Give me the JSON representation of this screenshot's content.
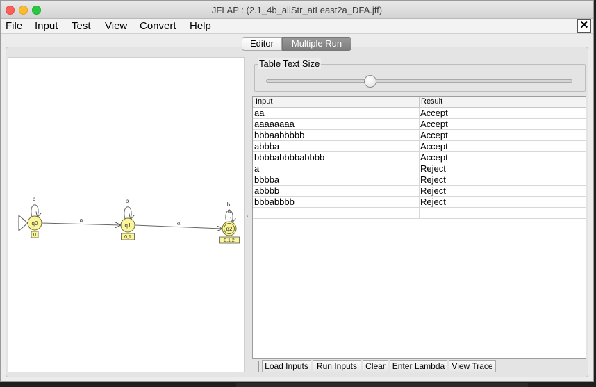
{
  "window": {
    "title": "JFLAP : (2.1_4b_allStr_atLeast2a_DFA.jff)"
  },
  "menu": {
    "items": [
      "File",
      "Input",
      "Test",
      "View",
      "Convert",
      "Help"
    ],
    "close_label": "✕"
  },
  "tabs": [
    "Editor",
    "Multiple Run"
  ],
  "automaton": {
    "states": [
      {
        "name": "q0",
        "label": "0",
        "initial": true,
        "final": false
      },
      {
        "name": "q1",
        "label": "0,1",
        "initial": false,
        "final": false
      },
      {
        "name": "q2",
        "label": "0,1,2",
        "initial": false,
        "final": true
      }
    ],
    "transitions": [
      {
        "from": "q0",
        "to": "q0",
        "symbol": "b"
      },
      {
        "from": "q0",
        "to": "q1",
        "symbol": "a"
      },
      {
        "from": "q1",
        "to": "q1",
        "symbol": "b"
      },
      {
        "from": "q1",
        "to": "q2",
        "symbol": "a"
      },
      {
        "from": "q2",
        "to": "q2",
        "symbol": "b"
      },
      {
        "from": "q2",
        "to": "q2",
        "symbol": "a"
      }
    ]
  },
  "table_text_size": {
    "label": "Table Text Size",
    "slider_fraction": 0.34
  },
  "table": {
    "headers": [
      "Input",
      "Result"
    ],
    "rows": [
      [
        "aa",
        "Accept"
      ],
      [
        "aaaaaaaa",
        "Accept"
      ],
      [
        "bbbaabbbbb",
        "Accept"
      ],
      [
        "abbba",
        "Accept"
      ],
      [
        "bbbbabbbbabbbb",
        "Accept"
      ],
      [
        "a",
        "Reject"
      ],
      [
        "bbbba",
        "Reject"
      ],
      [
        "abbbb",
        "Reject"
      ],
      [
        "bbbabbbb",
        "Reject"
      ],
      [
        "",
        ""
      ]
    ]
  },
  "toolbar": {
    "buttons": [
      "Load Inputs",
      "Run Inputs",
      "Clear",
      "Enter Lambda",
      "View Trace"
    ]
  },
  "colors": {
    "state_fill": "#fbf59a",
    "state_stroke": "#6b6b30",
    "label_fill": "#fbf59a"
  }
}
